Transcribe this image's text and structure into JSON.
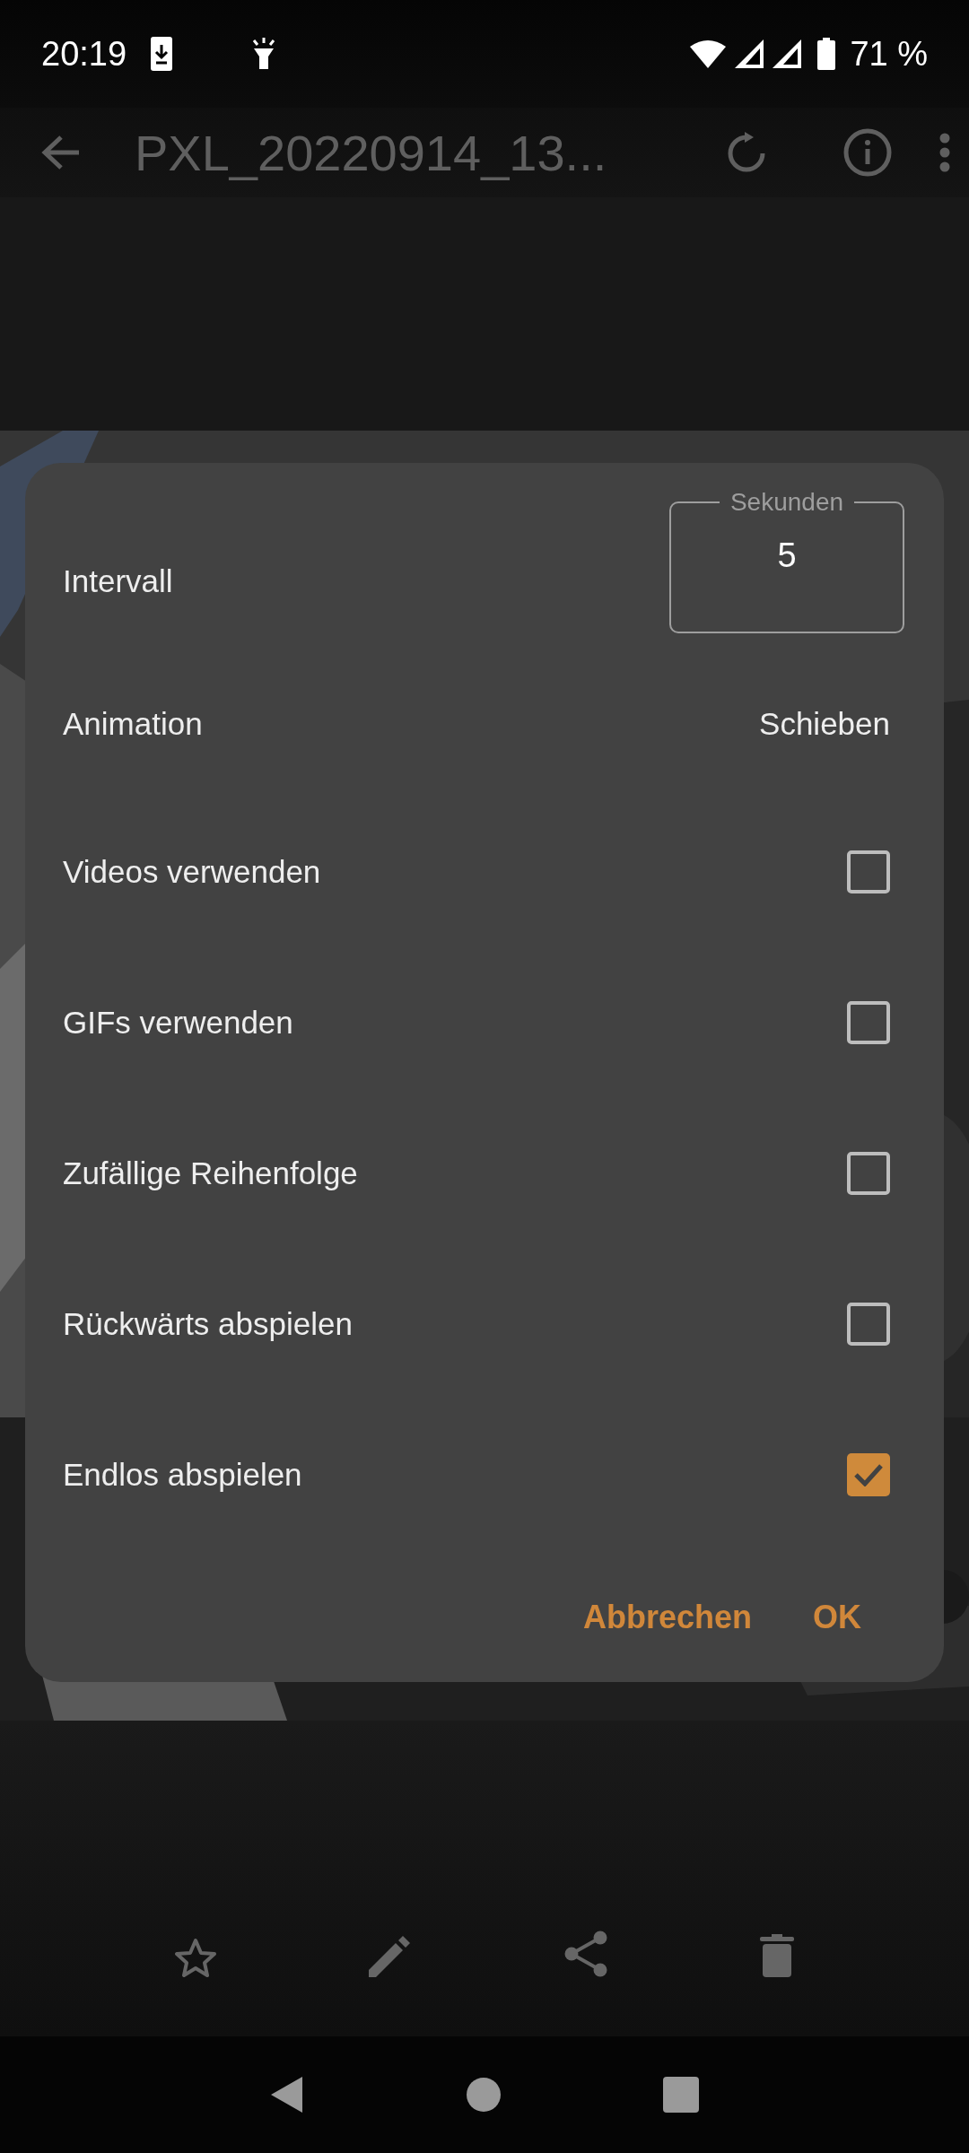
{
  "status_bar": {
    "time": "20:19",
    "battery": "71 %"
  },
  "toolbar": {
    "title": "PXL_20220914_13..."
  },
  "dialog": {
    "interval": {
      "label": "Intervall",
      "field_label": "Sekunden",
      "value": "5"
    },
    "animation": {
      "label": "Animation",
      "value": "Schieben"
    },
    "options": [
      {
        "label": "Videos verwenden",
        "checked": false
      },
      {
        "label": "GIFs verwenden",
        "checked": false
      },
      {
        "label": "Zufällige Reihenfolge",
        "checked": false
      },
      {
        "label": "Rückwärts abspielen",
        "checked": false
      },
      {
        "label": "Endlos abspielen",
        "checked": true
      }
    ],
    "buttons": [
      {
        "label": "Abbrechen"
      },
      {
        "label": "OK"
      }
    ]
  }
}
